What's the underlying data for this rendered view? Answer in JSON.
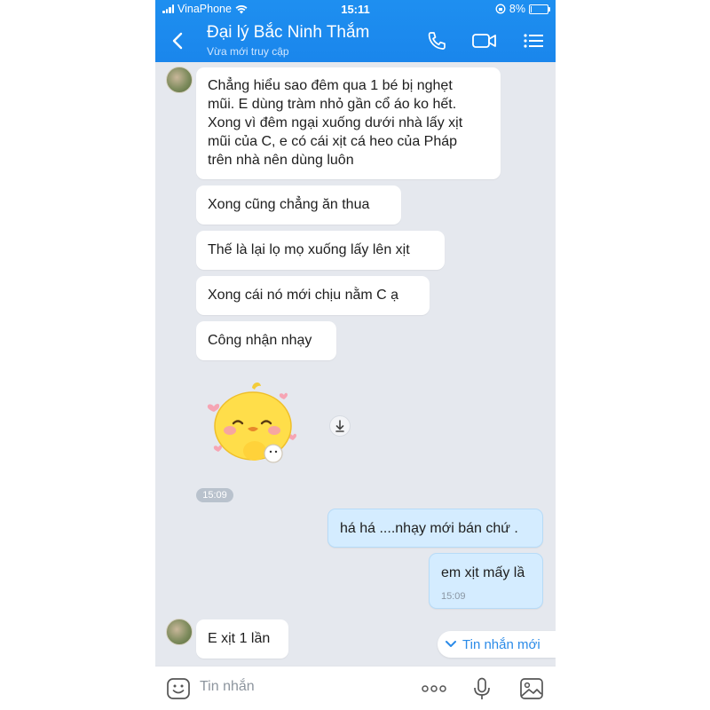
{
  "status": {
    "carrier": "VinaPhone",
    "time": "15:11",
    "battery": "8%",
    "battery_level": 0.08
  },
  "header": {
    "title": "Đại lý Bắc Ninh Thắm",
    "subtitle": "Vừa mới truy cập"
  },
  "messages": [
    {
      "dir": "in",
      "text_lines": [
        "Chẳng hiểu sao đêm qua 1 bé bị nghẹt",
        "mũi. E dùng tràm nhỏ gần cổ áo ko hết.",
        "Xong vì đêm ngại xuống dưới nhà lấy xịt",
        "mũi của C, e có cái xịt cá heo của Pháp",
        "trên nhà nên dùng luôn"
      ]
    },
    {
      "dir": "in",
      "text": "Xong cũng chẳng ăn thua"
    },
    {
      "dir": "in",
      "text": "Thế là lại lọ mọ xuống lấy lên xịt"
    },
    {
      "dir": "in",
      "text": "Xong cái nó mới chịu nằm C ạ"
    },
    {
      "dir": "in",
      "text": "Công nhận nhạy"
    },
    {
      "dir": "in",
      "type": "sticker",
      "sticker": "yellow-chick-sticker",
      "time": "15:09"
    },
    {
      "dir": "out",
      "text": "há há ....nhạy mới bán chứ ."
    },
    {
      "dir": "out",
      "text": "em xịt mấy lầ",
      "time": "15:09"
    },
    {
      "dir": "in",
      "text": "E xịt 1 lần"
    }
  ],
  "new_messages_label": "Tin nhắn mới",
  "input": {
    "placeholder": "Tin nhắn"
  },
  "icons": {
    "header": [
      "back-icon",
      "phone-icon",
      "video-call-icon",
      "menu-list-icon"
    ],
    "input_bar": [
      "emoji-icon",
      "more-icon",
      "microphone-icon",
      "image-icon"
    ]
  },
  "colors": {
    "header_bg": "#1a86ec",
    "chat_bg": "#e5e8ee",
    "outgoing_bubble": "#d4ecff",
    "accent": "#2b8be8"
  }
}
